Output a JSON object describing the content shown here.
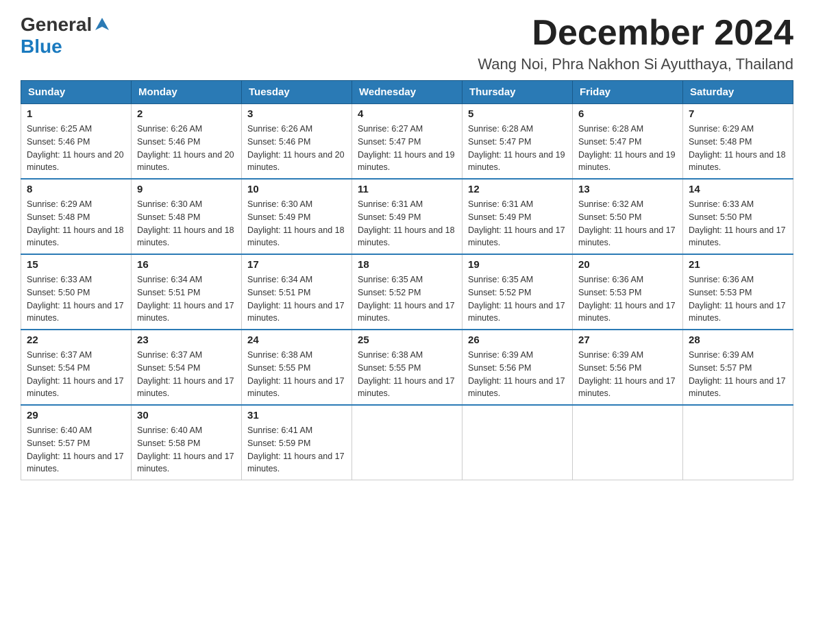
{
  "header": {
    "logo": {
      "general": "General",
      "blue": "Blue",
      "arrow_color": "#2a7ab5"
    },
    "title": "December 2024",
    "location": "Wang Noi, Phra Nakhon Si Ayutthaya, Thailand"
  },
  "calendar": {
    "days_of_week": [
      "Sunday",
      "Monday",
      "Tuesday",
      "Wednesday",
      "Thursday",
      "Friday",
      "Saturday"
    ],
    "weeks": [
      [
        {
          "day": "1",
          "sunrise": "6:25 AM",
          "sunset": "5:46 PM",
          "daylight": "11 hours and 20 minutes."
        },
        {
          "day": "2",
          "sunrise": "6:26 AM",
          "sunset": "5:46 PM",
          "daylight": "11 hours and 20 minutes."
        },
        {
          "day": "3",
          "sunrise": "6:26 AM",
          "sunset": "5:46 PM",
          "daylight": "11 hours and 20 minutes."
        },
        {
          "day": "4",
          "sunrise": "6:27 AM",
          "sunset": "5:47 PM",
          "daylight": "11 hours and 19 minutes."
        },
        {
          "day": "5",
          "sunrise": "6:28 AM",
          "sunset": "5:47 PM",
          "daylight": "11 hours and 19 minutes."
        },
        {
          "day": "6",
          "sunrise": "6:28 AM",
          "sunset": "5:47 PM",
          "daylight": "11 hours and 19 minutes."
        },
        {
          "day": "7",
          "sunrise": "6:29 AM",
          "sunset": "5:48 PM",
          "daylight": "11 hours and 18 minutes."
        }
      ],
      [
        {
          "day": "8",
          "sunrise": "6:29 AM",
          "sunset": "5:48 PM",
          "daylight": "11 hours and 18 minutes."
        },
        {
          "day": "9",
          "sunrise": "6:30 AM",
          "sunset": "5:48 PM",
          "daylight": "11 hours and 18 minutes."
        },
        {
          "day": "10",
          "sunrise": "6:30 AM",
          "sunset": "5:49 PM",
          "daylight": "11 hours and 18 minutes."
        },
        {
          "day": "11",
          "sunrise": "6:31 AM",
          "sunset": "5:49 PM",
          "daylight": "11 hours and 18 minutes."
        },
        {
          "day": "12",
          "sunrise": "6:31 AM",
          "sunset": "5:49 PM",
          "daylight": "11 hours and 17 minutes."
        },
        {
          "day": "13",
          "sunrise": "6:32 AM",
          "sunset": "5:50 PM",
          "daylight": "11 hours and 17 minutes."
        },
        {
          "day": "14",
          "sunrise": "6:33 AM",
          "sunset": "5:50 PM",
          "daylight": "11 hours and 17 minutes."
        }
      ],
      [
        {
          "day": "15",
          "sunrise": "6:33 AM",
          "sunset": "5:50 PM",
          "daylight": "11 hours and 17 minutes."
        },
        {
          "day": "16",
          "sunrise": "6:34 AM",
          "sunset": "5:51 PM",
          "daylight": "11 hours and 17 minutes."
        },
        {
          "day": "17",
          "sunrise": "6:34 AM",
          "sunset": "5:51 PM",
          "daylight": "11 hours and 17 minutes."
        },
        {
          "day": "18",
          "sunrise": "6:35 AM",
          "sunset": "5:52 PM",
          "daylight": "11 hours and 17 minutes."
        },
        {
          "day": "19",
          "sunrise": "6:35 AM",
          "sunset": "5:52 PM",
          "daylight": "11 hours and 17 minutes."
        },
        {
          "day": "20",
          "sunrise": "6:36 AM",
          "sunset": "5:53 PM",
          "daylight": "11 hours and 17 minutes."
        },
        {
          "day": "21",
          "sunrise": "6:36 AM",
          "sunset": "5:53 PM",
          "daylight": "11 hours and 17 minutes."
        }
      ],
      [
        {
          "day": "22",
          "sunrise": "6:37 AM",
          "sunset": "5:54 PM",
          "daylight": "11 hours and 17 minutes."
        },
        {
          "day": "23",
          "sunrise": "6:37 AM",
          "sunset": "5:54 PM",
          "daylight": "11 hours and 17 minutes."
        },
        {
          "day": "24",
          "sunrise": "6:38 AM",
          "sunset": "5:55 PM",
          "daylight": "11 hours and 17 minutes."
        },
        {
          "day": "25",
          "sunrise": "6:38 AM",
          "sunset": "5:55 PM",
          "daylight": "11 hours and 17 minutes."
        },
        {
          "day": "26",
          "sunrise": "6:39 AM",
          "sunset": "5:56 PM",
          "daylight": "11 hours and 17 minutes."
        },
        {
          "day": "27",
          "sunrise": "6:39 AM",
          "sunset": "5:56 PM",
          "daylight": "11 hours and 17 minutes."
        },
        {
          "day": "28",
          "sunrise": "6:39 AM",
          "sunset": "5:57 PM",
          "daylight": "11 hours and 17 minutes."
        }
      ],
      [
        {
          "day": "29",
          "sunrise": "6:40 AM",
          "sunset": "5:57 PM",
          "daylight": "11 hours and 17 minutes."
        },
        {
          "day": "30",
          "sunrise": "6:40 AM",
          "sunset": "5:58 PM",
          "daylight": "11 hours and 17 minutes."
        },
        {
          "day": "31",
          "sunrise": "6:41 AM",
          "sunset": "5:59 PM",
          "daylight": "11 hours and 17 minutes."
        },
        null,
        null,
        null,
        null
      ]
    ],
    "labels": {
      "sunrise": "Sunrise:",
      "sunset": "Sunset:",
      "daylight": "Daylight:"
    }
  }
}
